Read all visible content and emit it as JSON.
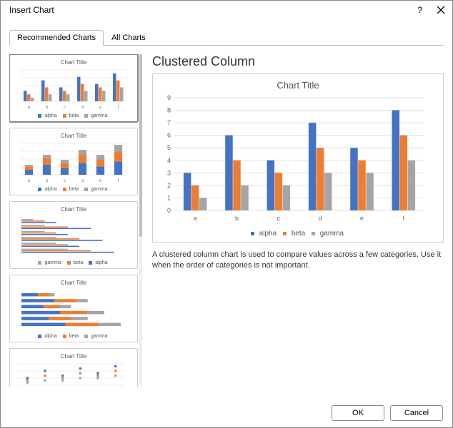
{
  "window": {
    "title": "Insert Chart",
    "help": "?",
    "close": "✕"
  },
  "tabs": {
    "recommended": "Recommended Charts",
    "all": "All Charts"
  },
  "thumbs": {
    "title_generic": "Chart Title",
    "legend_alpha": "alpha",
    "legend_beta": "beta",
    "legend_gamma": "gamma"
  },
  "preview": {
    "heading": "Clustered Column",
    "chart_title": "Chart Title",
    "legend": {
      "alpha": "alpha",
      "beta": "beta",
      "gamma": "gamma"
    },
    "description": "A clustered column chart is used to compare values across a few categories. Use it when the order of categories is not important."
  },
  "buttons": {
    "ok": "OK",
    "cancel": "Cancel"
  },
  "colors": {
    "alpha": "#4472C4",
    "beta": "#ED7D31",
    "gamma": "#A5A5A5"
  },
  "chart_data": {
    "type": "bar",
    "title": "Chart Title",
    "xlabel": "",
    "ylabel": "",
    "ylim": [
      0,
      9
    ],
    "yticks": [
      0,
      1,
      2,
      3,
      4,
      5,
      6,
      7,
      8,
      9
    ],
    "categories": [
      "a",
      "b",
      "c",
      "d",
      "e",
      "f"
    ],
    "series": [
      {
        "name": "alpha",
        "values": [
          3,
          6,
          4,
          7,
          5,
          8
        ]
      },
      {
        "name": "beta",
        "values": [
          2,
          4,
          3,
          5,
          4,
          6
        ]
      },
      {
        "name": "gamma",
        "values": [
          1,
          2,
          2,
          3,
          3,
          4
        ]
      }
    ]
  }
}
